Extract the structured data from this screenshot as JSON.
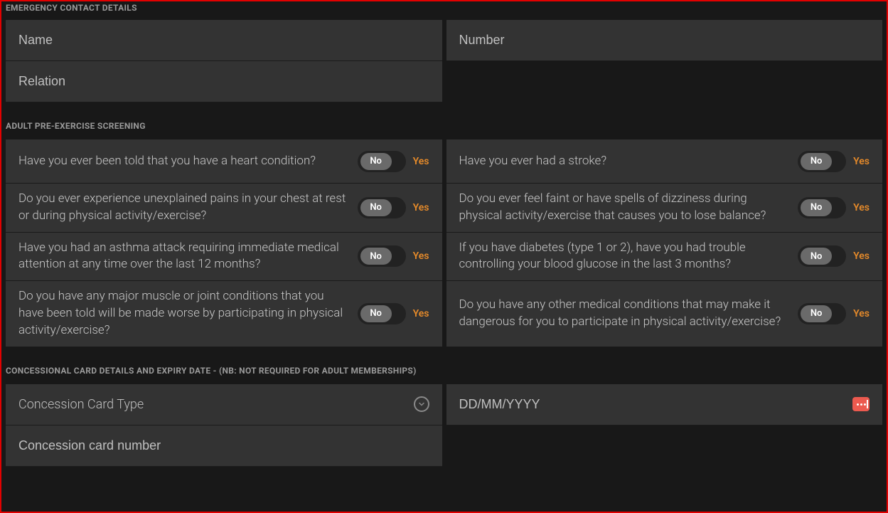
{
  "sections": {
    "emergency": {
      "title": "EMERGENCY CONTACT DETAILS"
    },
    "screening": {
      "title": "ADULT PRE-EXERCISE SCREENING"
    },
    "concession": {
      "title": "CONCESSIONAL CARD DETAILS AND EXPIRY DATE - (NB: NOT REQUIRED FOR ADULT MEMBERSHIPS)"
    }
  },
  "emergency_fields": {
    "name": "Name",
    "number": "Number",
    "relation": "Relation"
  },
  "toggle": {
    "no": "No",
    "yes": "Yes"
  },
  "questions": [
    {
      "text": "Have you ever been told that you have a heart condition?"
    },
    {
      "text": "Have you ever had a stroke?"
    },
    {
      "text": "Do you ever experience unexplained pains in your chest at rest or during physical activity/exercise?"
    },
    {
      "text": "Do you ever feel faint or have spells of dizziness during physical activity/exercise that causes you to lose balance?"
    },
    {
      "text": "Have you had an asthma attack requiring immediate medical attention at any time over the last 12 months?"
    },
    {
      "text": "If you have diabetes (type 1 or 2), have you had trouble controlling your blood glucose in the last 3 months?"
    },
    {
      "text": "Do you have any major muscle or joint conditions that you have been told will be made worse by participating in physical activity/exercise?"
    },
    {
      "text": "Do you have any other medical conditions that may make it dangerous for you to participate in physical activity/exercise?"
    }
  ],
  "concession_fields": {
    "card_type": "Concession Card Type",
    "expiry_placeholder": "DD/MM/YYYY",
    "card_number": "Concession card number"
  }
}
